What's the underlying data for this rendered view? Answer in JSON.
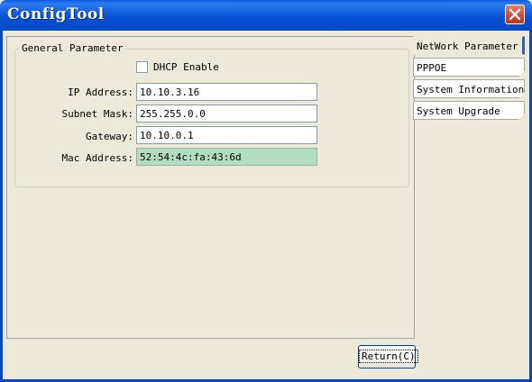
{
  "window": {
    "title": "ConfigTool"
  },
  "general": {
    "group_title": "General Parameter",
    "dhcp_label": "DHCP Enable",
    "dhcp_checked": false,
    "ip_label": "IP Address:",
    "ip_value": "10.10.3.16",
    "subnet_label": "Subnet Mask:",
    "subnet_value": "255.255.0.0",
    "gateway_label": "Gateway:",
    "gateway_value": "10.10.0.1",
    "mac_label": "Mac Address:",
    "mac_value": "52:54:4c:fa:43:6d"
  },
  "tabs": [
    {
      "label": "NetWork Parameter",
      "active": true
    },
    {
      "label": "PPPOE",
      "active": false
    },
    {
      "label": "System Information",
      "active": false
    },
    {
      "label": "System Upgrade",
      "active": false
    }
  ],
  "buttons": {
    "return_label": "Return(C)"
  },
  "icons": {
    "close": "close-icon"
  },
  "colors": {
    "titlebar": "#0653d6",
    "close": "#d8432a",
    "readonly_field": "#b4dcc0"
  }
}
